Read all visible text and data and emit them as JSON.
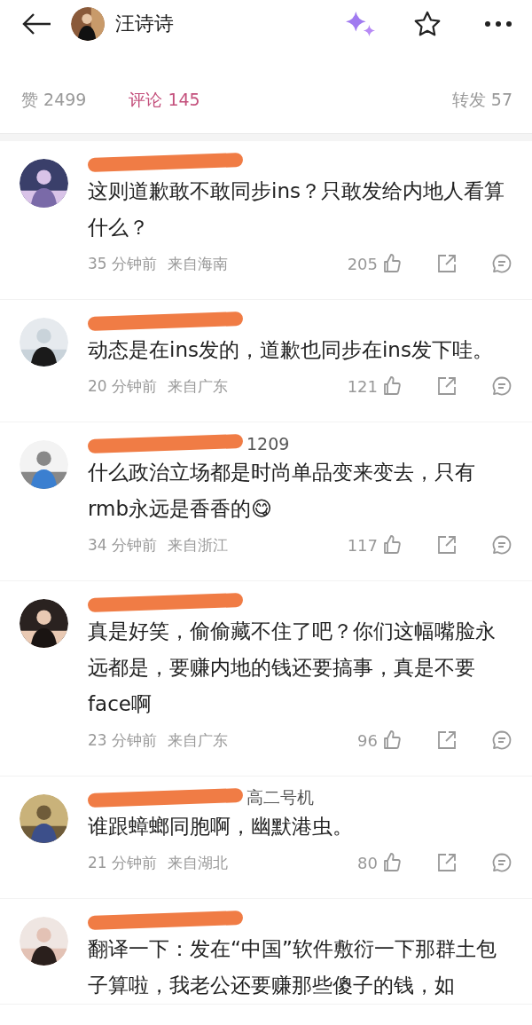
{
  "header": {
    "title": "汪诗诗"
  },
  "tabs": [
    {
      "label": "赞 2499",
      "selected": false
    },
    {
      "label": "评论 145",
      "selected": true
    },
    {
      "label": "转发 57",
      "selected": false
    }
  ],
  "comments": [
    {
      "text": "这则道歉敢不敢同步ins？只敢发给内地人看算什么？",
      "time": "35 分钟前",
      "location": "来自海南",
      "likes": "205"
    },
    {
      "text": "动态是在ins发的，道歉也同步在ins发下哇。",
      "time": "20 分钟前",
      "location": "来自广东",
      "likes": "121"
    },
    {
      "username": "1209",
      "text": "什么政治立场都是时尚单品变来变去，只有rmb永远是香香的😋",
      "time": "34 分钟前",
      "location": "来自浙江",
      "likes": "117"
    },
    {
      "text": "真是好笑，偷偷藏不住了吧？你们这幅嘴脸永远都是，要赚内地的钱还要搞事，真是不要face啊",
      "time": "23 分钟前",
      "location": "来自广东",
      "likes": "96"
    },
    {
      "username": "高二号机",
      "text": "谁跟蟑螂同胞啊，幽默港虫。",
      "time": "21 分钟前",
      "location": "来自湖北",
      "likes": "80"
    },
    {
      "text": "翻译一下：发在“中国”软件敷衍一下那群土包子算啦，我老公还要赚那些傻子的钱，如"
    }
  ]
}
